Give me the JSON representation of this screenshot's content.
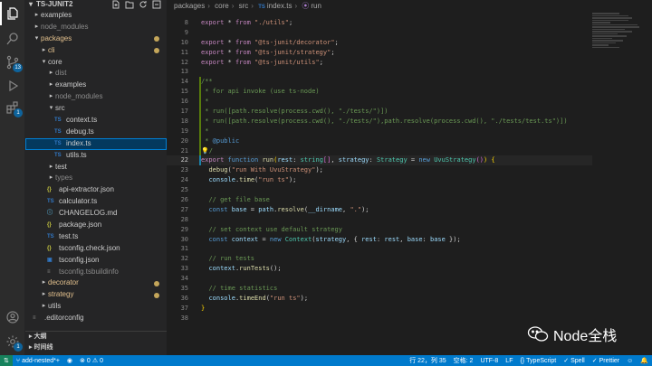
{
  "sidebar": {
    "title": "TS-JUNIT2",
    "tree": [
      {
        "label": "examples",
        "arrow": "▸",
        "indent": 1,
        "kind": "folder",
        "dim": false
      },
      {
        "label": "node_modules",
        "arrow": "▸",
        "indent": 1,
        "kind": "folder",
        "dim": true
      },
      {
        "label": "packages",
        "arrow": "▾",
        "indent": 1,
        "kind": "folder",
        "hl": true,
        "mod": true
      },
      {
        "label": "cli",
        "arrow": "▸",
        "indent": 2,
        "kind": "folder",
        "hl": true,
        "mod": true
      },
      {
        "label": "core",
        "arrow": "▾",
        "indent": 2,
        "kind": "folder"
      },
      {
        "label": "dist",
        "arrow": "▸",
        "indent": 3,
        "kind": "folder",
        "dim": true
      },
      {
        "label": "examples",
        "arrow": "▸",
        "indent": 3,
        "kind": "folder"
      },
      {
        "label": "node_modules",
        "arrow": "▸",
        "indent": 3,
        "kind": "folder",
        "dim": true
      },
      {
        "label": "src",
        "arrow": "▾",
        "indent": 3,
        "kind": "folder"
      },
      {
        "label": "context.ts",
        "icon": "TS",
        "indent": 4,
        "kind": "ts"
      },
      {
        "label": "debug.ts",
        "icon": "TS",
        "indent": 4,
        "kind": "ts"
      },
      {
        "label": "index.ts",
        "icon": "TS",
        "indent": 4,
        "kind": "ts",
        "selected": true
      },
      {
        "label": "utils.ts",
        "icon": "TS",
        "indent": 4,
        "kind": "ts"
      },
      {
        "label": "test",
        "arrow": "▸",
        "indent": 3,
        "kind": "folder"
      },
      {
        "label": "types",
        "arrow": "▸",
        "indent": 3,
        "kind": "folder",
        "dim": true
      },
      {
        "label": "api-extractor.json",
        "icon": "{}",
        "indent": 3,
        "kind": "json"
      },
      {
        "label": "calculator.ts",
        "icon": "TS",
        "indent": 3,
        "kind": "ts"
      },
      {
        "label": "CHANGELOG.md",
        "icon": "ⓘ",
        "indent": 3,
        "kind": "md"
      },
      {
        "label": "package.json",
        "icon": "{}",
        "indent": 3,
        "kind": "json"
      },
      {
        "label": "test.ts",
        "icon": "TS",
        "indent": 3,
        "kind": "ts"
      },
      {
        "label": "tsconfig.check.json",
        "icon": "{}",
        "indent": 3,
        "kind": "json"
      },
      {
        "label": "tsconfig.json",
        "icon": "▣",
        "indent": 3,
        "kind": "cfg"
      },
      {
        "label": "tsconfig.tsbuildinfo",
        "icon": "≡",
        "indent": 3,
        "kind": "gen",
        "dim": true
      },
      {
        "label": "decorator",
        "arrow": "▸",
        "indent": 2,
        "kind": "folder",
        "hl": true,
        "mod": true
      },
      {
        "label": "strategy",
        "arrow": "▸",
        "indent": 2,
        "kind": "folder",
        "hl": true,
        "mod": true
      },
      {
        "label": "utils",
        "arrow": "▸",
        "indent": 2,
        "kind": "folder"
      },
      {
        "label": ".editorconfig",
        "icon": "≡",
        "indent": 1,
        "kind": "gen"
      }
    ],
    "panels": [
      {
        "label": "大纲"
      },
      {
        "label": "时间线"
      }
    ]
  },
  "activity": {
    "scm_badge": "13",
    "ext_badge": "1",
    "settings_badge": "1"
  },
  "breadcrumb": {
    "parts": [
      "packages",
      "core",
      "src",
      "index.ts",
      "run"
    ]
  },
  "code": [
    {
      "n": "8",
      "gut": "",
      "html": "<span class='kw'>export</span> <span class='p'>*</span> <span class='kw'>from</span> <span class='s'>\"./utils\"</span>;"
    },
    {
      "n": "9",
      "gut": "",
      "html": ""
    },
    {
      "n": "10",
      "gut": "",
      "html": "<span class='kw'>export</span> <span class='p'>*</span> <span class='kw'>from</span> <span class='s'>\"@ts-junit/decorator\"</span>;"
    },
    {
      "n": "11",
      "gut": "",
      "html": "<span class='kw'>export</span> <span class='p'>*</span> <span class='kw'>from</span> <span class='s'>\"@ts-junit/strategy\"</span>;"
    },
    {
      "n": "12",
      "gut": "",
      "html": "<span class='kw'>export</span> <span class='p'>*</span> <span class='kw'>from</span> <span class='s'>\"@ts-junit/utils\"</span>;"
    },
    {
      "n": "13",
      "gut": "",
      "html": ""
    },
    {
      "n": "14",
      "gut": "g",
      "html": "<span class='c'>/**</span>"
    },
    {
      "n": "15",
      "gut": "g",
      "html": "<span class='c'> * for api invoke (use ts-node)</span>"
    },
    {
      "n": "16",
      "gut": "g",
      "html": "<span class='c'> *</span>"
    },
    {
      "n": "17",
      "gut": "g",
      "html": "<span class='c'> * run([path.resolve(process.cwd(), \"./tests/\")])</span>"
    },
    {
      "n": "18",
      "gut": "g",
      "html": "<span class='c'> * run([path.resolve(process.cwd(), \"./tests/\"),path.resolve(process.cwd(), \"./tests/test.ts\")])</span>"
    },
    {
      "n": "19",
      "gut": "g",
      "html": "<span class='c'> *</span>"
    },
    {
      "n": "20",
      "gut": "g",
      "html": "<span class='c'> * </span><span class='k'>@public</span>"
    },
    {
      "n": "21",
      "gut": "g",
      "html": "<span class='br'>💡</span><span class='c'>/</span>"
    },
    {
      "n": "22",
      "gut": "b",
      "cur": true,
      "html": "<span class='kw'>export</span> <span class='k'>function</span> <span class='f'>run</span><span class='br'>(</span><span class='v'>rest</span>: <span class='t'>string</span><span class='bb'>[]</span>, <span class='v'>strategy</span>: <span class='t'>Strategy</span> = <span class='k'>new</span> <span class='t'>UvuStrategy</span><span class='bb'>()</span><span class='br'>)</span> <span class='br'>{</span>"
    },
    {
      "n": "23",
      "gut": "",
      "html": "  <span class='f'>debug</span>(<span class='s'>\"run With UvuStrategy\"</span>);"
    },
    {
      "n": "24",
      "gut": "",
      "html": "  <span class='v'>console</span>.<span class='f'>time</span>(<span class='s'>\"run ts\"</span>);"
    },
    {
      "n": "25",
      "gut": "",
      "html": ""
    },
    {
      "n": "26",
      "gut": "",
      "html": "  <span class='c'>// get file base</span>"
    },
    {
      "n": "27",
      "gut": "",
      "html": "  <span class='k'>const</span> <span class='v'>base</span> = <span class='v'>path</span>.<span class='f'>resolve</span>(<span class='v'>__dirname</span>, <span class='s'>\".\"</span>);"
    },
    {
      "n": "28",
      "gut": "",
      "html": ""
    },
    {
      "n": "29",
      "gut": "",
      "html": "  <span class='c'>// set context use default strategy</span>"
    },
    {
      "n": "30",
      "gut": "",
      "html": "  <span class='k'>const</span> <span class='v'>context</span> = <span class='k'>new</span> <span class='t'>Context</span>(<span class='v'>strategy</span>, { <span class='v'>rest</span>: <span class='v'>rest</span>, <span class='v'>base</span>: <span class='v'>base</span> });"
    },
    {
      "n": "31",
      "gut": "",
      "html": ""
    },
    {
      "n": "32",
      "gut": "",
      "html": "  <span class='c'>// run tests</span>"
    },
    {
      "n": "33",
      "gut": "",
      "html": "  <span class='v'>context</span>.<span class='f'>runTests</span>();"
    },
    {
      "n": "34",
      "gut": "",
      "html": ""
    },
    {
      "n": "35",
      "gut": "",
      "html": "  <span class='c'>// time statistics</span>"
    },
    {
      "n": "36",
      "gut": "",
      "html": "  <span class='v'>console</span>.<span class='f'>timeEnd</span>(<span class='s'>\"run ts\"</span>);"
    },
    {
      "n": "37",
      "gut": "",
      "html": "<span class='br'>}</span>"
    },
    {
      "n": "38",
      "gut": "",
      "html": ""
    }
  ],
  "watermark": {
    "text": "Node全栈"
  },
  "status": {
    "branch": "add-nested*+",
    "errors": "0",
    "warnings": "0",
    "position": "行 22，列 35",
    "spaces": "空格: 2",
    "encoding": "UTF-8",
    "eol": "LF",
    "language": "TypeScript",
    "spell": "Spell",
    "prettier": "Prettier"
  },
  "colors": {
    "statusbar": "#007acc",
    "selection": "#04395e",
    "modified": "#c4a65a"
  }
}
